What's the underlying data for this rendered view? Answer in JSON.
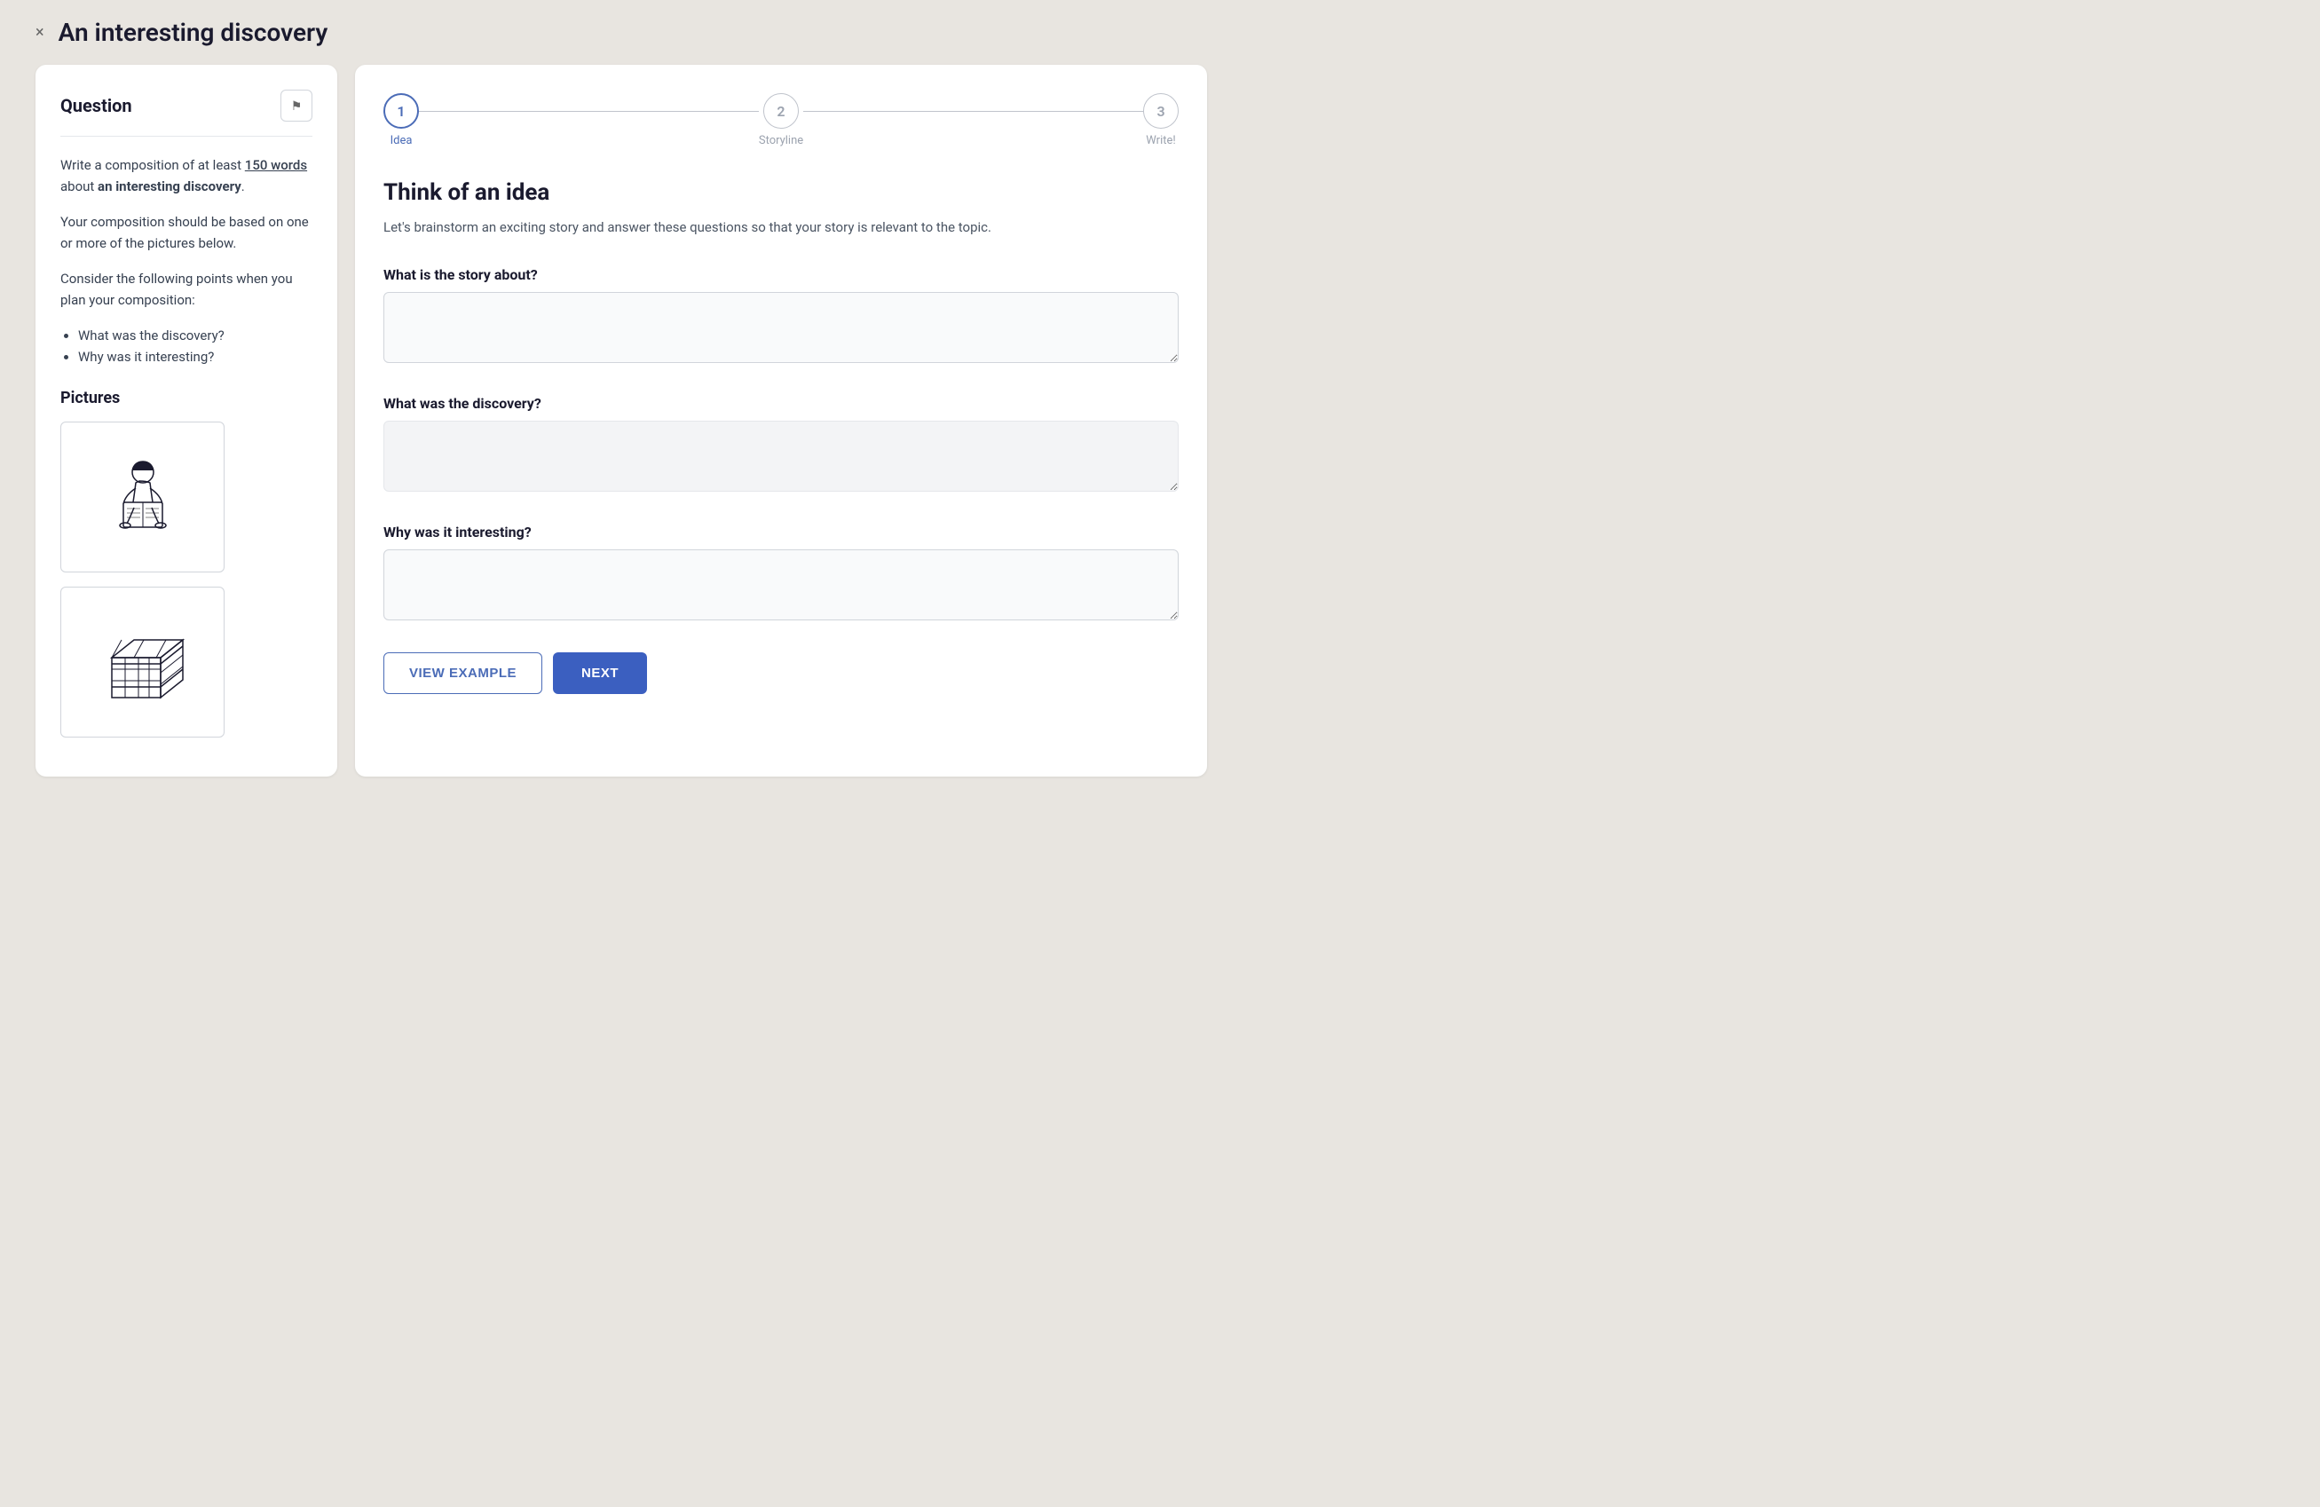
{
  "header": {
    "title": "An interesting discovery",
    "close_icon": "×"
  },
  "left_panel": {
    "title": "Question",
    "flag_icon": "⚑",
    "instruction_line1": "Write a composition of at least ",
    "word_count": "150 words",
    "instruction_line2": " about ",
    "bold_topic": "an interesting discovery",
    "instruction_end": ".",
    "paragraph2": "Your composition should be based on one or more of the pictures below.",
    "paragraph3": "Consider the following points when you plan your composition:",
    "bullets": [
      "What was the discovery?",
      "Why was it interesting?"
    ],
    "pictures_title": "Pictures"
  },
  "right_panel": {
    "steps": [
      {
        "number": "1",
        "label": "Idea",
        "active": true
      },
      {
        "number": "2",
        "label": "Storyline",
        "active": false
      },
      {
        "number": "3",
        "label": "Write!",
        "active": false
      }
    ],
    "heading": "Think of an idea",
    "subtitle": "Let's brainstorm an exciting story and answer these questions so that your story is relevant to the topic.",
    "questions": [
      {
        "label": "What is the story about?",
        "placeholder": "",
        "id": "q1"
      },
      {
        "label": "What was the discovery?",
        "placeholder": "",
        "id": "q2"
      },
      {
        "label": "Why was it interesting?",
        "placeholder": "",
        "id": "q3"
      }
    ],
    "buttons": {
      "view_example": "VIEW EXAMPLE",
      "next": "NEXT"
    }
  }
}
